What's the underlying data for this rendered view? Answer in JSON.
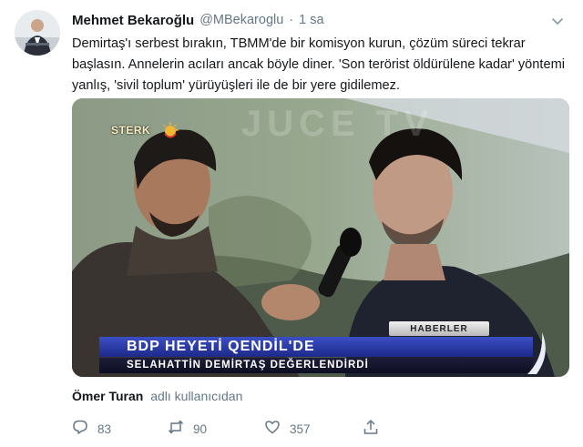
{
  "tweet": {
    "author_name": "Mehmet Bekaroğlu",
    "handle": "@MBekaroglu",
    "separator": "·",
    "time": "1 sa",
    "text": "Demirtaş'ı serbest bırakın, TBMM'de bir komisyon kurun, çözüm süreci tekrar başlasın. Annelerin acıları ancak böyle diner. 'Son terörist öldürülene kadar' yöntemi yanlış, 'sivil toplum' yürüyüşleri ile de bir yere gidilemez."
  },
  "media": {
    "channel_logo": "STERK",
    "watermark": "JUCE TV",
    "tag": "HABERLER",
    "headline": "BDP HEYETİ QENDİL'DE",
    "subline": "SELAHATTİN DEMİRTAŞ DEĞERLENDİRDİ"
  },
  "retweet_info": {
    "name": "Ömer Turan",
    "suffix": "adlı kullanıcıdan"
  },
  "actions": {
    "reply_count": "83",
    "retweet_count": "90",
    "like_count": "357"
  },
  "icons": {
    "reply": "reply-icon",
    "retweet": "retweet-icon",
    "like": "heart-icon",
    "share": "share-icon",
    "menu": "chevron-down-icon"
  },
  "colors": {
    "text": "#14171a",
    "secondary": "#657786",
    "lower_third": "#2a3aa8"
  }
}
